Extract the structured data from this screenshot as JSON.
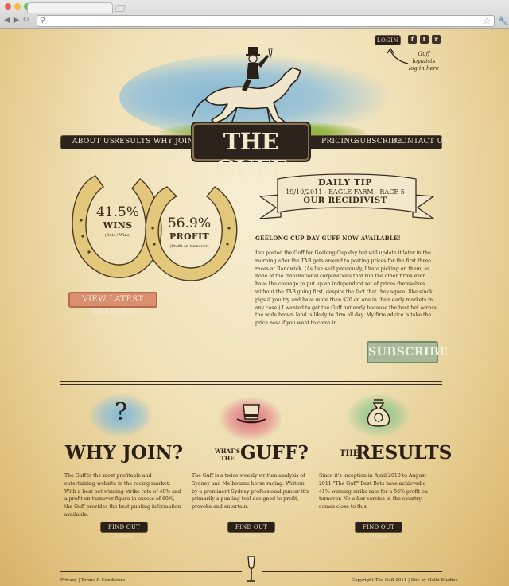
{
  "browser": {
    "traffic_colors": [
      "#ee5d52",
      "#f2be3c",
      "#5cc74a"
    ]
  },
  "header": {
    "login_label": "LOGIN",
    "login_hint": "Guff loyalists log in here",
    "social": [
      "f",
      "t",
      "r"
    ]
  },
  "nav": {
    "items_left": [
      "ABOUT US",
      "RESULTS",
      "WHY JOIN"
    ],
    "logo": "THE GUFF",
    "items_right": [
      "PRICING",
      "SUBSCRIBE",
      "CONTACT US"
    ]
  },
  "stats": {
    "wins_pct": "41.5%",
    "wins_label": "WINS",
    "wins_sub": "(Bets / Wins)",
    "profit_pct": "56.9%",
    "profit_label": "PROFIT",
    "profit_sub": "(Profit on turnover)",
    "results_button": "VIEW LATEST RESULTS"
  },
  "daily_tip": {
    "title": "DAILY TIP",
    "date_line": "19/10/2011 - EAGLE FARM - RACE 5",
    "horse": "OUR RECIDIVIST"
  },
  "article": {
    "headline": "GEELONG CUP DAY GUFF NOW AVAILABLE!",
    "body": "I've posted the Guff for Geelong Cup day but will update it later in the morning after the TAB gets around to posting prices for the first three races at Randwick. (As I've said previously, I hate picking on them, as none of the transnational corporations that run the other firms ever have the courage to put up an independent set of prices themselves without the TAB going first, despite the fact that they squeal like stuck pigs if you try and have more than $20 on one in their early markets in any case.) I wanted to get the Guff out early because the best bet across the wide brown land is likely to firm all day. My firm advice is take the price now if you want to come in.",
    "subscribe_button": "SUBSCRIBE"
  },
  "columns": [
    {
      "icon": "question-mark",
      "title_small": "",
      "title": "WHY JOIN?",
      "text": "The Guff is the most profitable and entertaining website in the racing market. With a best bet winning strike rate of 40% and a profit on turnover figure in excess of 60%, the Guff provides the best punting information available.",
      "button": "FIND OUT MORE"
    },
    {
      "icon": "top-hat",
      "title_small": "WHAT'S THE",
      "title": "GUFF?",
      "text": "The Guff is a twice weekly written analysis of Sydney and Melbourne horse racing. Written by a prominent Sydney professional punter it's primarily a punting tool designed to profit, provoke and entertain.",
      "button": "FIND OUT MORE"
    },
    {
      "icon": "money-bag",
      "title_small": "THE",
      "title": "RESULTS",
      "text": "Since it's inception in April 2010 to August 2011 \"The Guff\" Best Bets have achieved a 41% winning strike rate for a 56% profit on turnover. No other service in the country comes close to this.",
      "button": "FIND OUT MORE"
    }
  ],
  "footer": {
    "privacy": "Privacy",
    "terms": "Terms & Conditions",
    "copyright": "Copyright The Guff 2011",
    "credit": "Site by Hello Studios"
  }
}
